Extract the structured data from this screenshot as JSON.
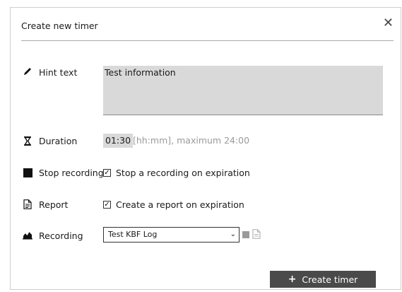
{
  "dialog": {
    "title": "Create new timer",
    "close_glyph": "✕"
  },
  "hint": {
    "label": "Hint text",
    "icon": "pencil-icon",
    "value": "Test information"
  },
  "duration": {
    "label": "Duration",
    "icon": "hourglass-icon",
    "value": "01:30",
    "hint": "[hh:mm], maximum 24:00"
  },
  "stop_recording": {
    "label": "Stop recording",
    "icon": "stop-square-icon",
    "checkbox_label": "Stop a recording on expiration",
    "checked": true
  },
  "report": {
    "label": "Report",
    "icon": "document-icon",
    "checkbox_label": "Create a report on expiration",
    "checked": true
  },
  "recording": {
    "label": "Recording",
    "icon": "area-chart-icon",
    "selected": "Test KBF Log"
  },
  "actions": {
    "create_label": "Create timer",
    "create_icon": "plus-icon"
  },
  "colors": {
    "button_bg": "#4a4a4a",
    "field_bg": "#d9d9d9"
  }
}
